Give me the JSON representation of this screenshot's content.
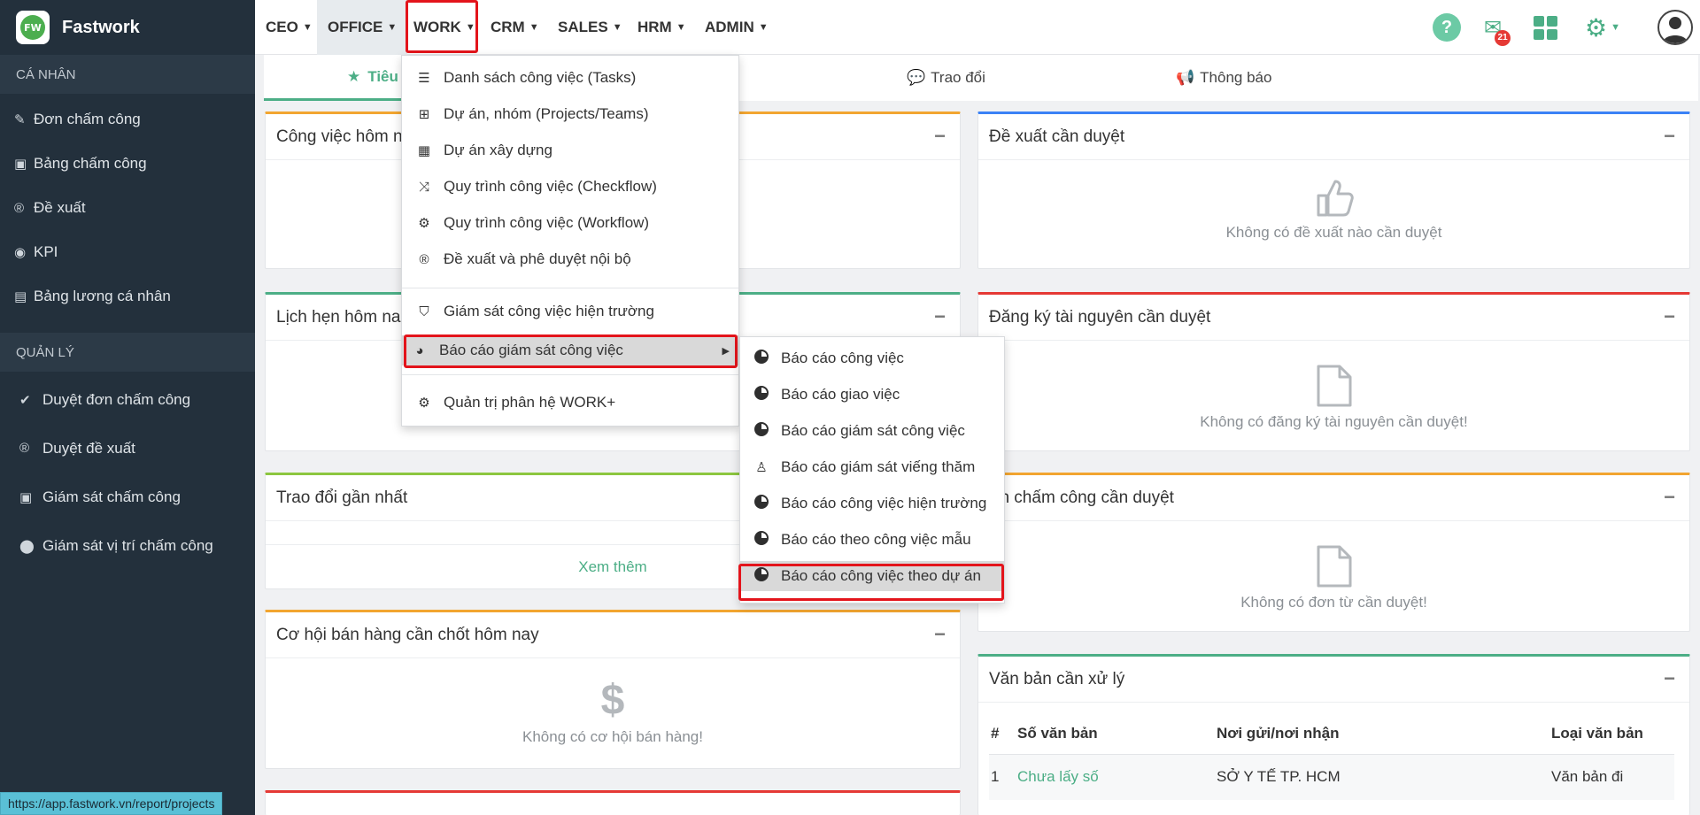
{
  "brand": {
    "name": "Fastwork",
    "logo_text": "FW"
  },
  "sidebar": {
    "personal_title": "CÁ NHÂN",
    "personal_items": [
      {
        "icon": "edit-icon",
        "label": "Đơn chấm công"
      },
      {
        "icon": "calendar-check-icon",
        "label": "Bảng chấm công"
      },
      {
        "icon": "registered-icon",
        "label": "Đề xuất"
      },
      {
        "icon": "eye-icon",
        "label": "KPI"
      },
      {
        "icon": "money-icon",
        "label": "Bảng lương cá nhân"
      }
    ],
    "manage_title": "QUẢN LÝ",
    "manage_items": [
      {
        "icon": "check-circle-icon",
        "label": "Duyệt đơn chấm công"
      },
      {
        "icon": "registered-icon",
        "label": "Duyệt đề xuất"
      },
      {
        "icon": "calendar-check-icon",
        "label": "Giám sát chấm công"
      },
      {
        "icon": "map-marker-icon",
        "label": "Giám sát vị trí chấm công"
      }
    ]
  },
  "status_url": "https://app.fastwork.vn/report/projects",
  "topnav": {
    "items": [
      "CEO",
      "OFFICE",
      "WORK",
      "CRM",
      "SALES",
      "HRM",
      "ADMIN"
    ],
    "mail_badge": "21"
  },
  "tabs": {
    "first": "Tiêu",
    "second": "Trao đổi",
    "third": "Thông báo"
  },
  "panels": {
    "today_tasks": {
      "title": "Công việc hôm n"
    },
    "appointments": {
      "title": "Lịch hẹn hôm na"
    },
    "recent": {
      "title": "Trao đổi gần nhất",
      "more": "Xem thêm"
    },
    "sales": {
      "title": "Cơ hội bán hàng cần chốt hôm nay",
      "empty": "Không có cơ hội bán hàng!",
      "icon_glyph": "$"
    },
    "proposals": {
      "title": "Đề xuất cần duyệt",
      "empty": "Không có đề xuất nào cần duyệt"
    },
    "resources": {
      "title": "Đăng ký tài nguyên cần duyệt",
      "empty": "Không có đăng ký tài nguyên cần duyệt!"
    },
    "attendance": {
      "title": "ơn chấm công cần duyệt",
      "empty": "Không có đơn từ cần duyệt!"
    },
    "documents": {
      "title": "Văn bản cần xử lý",
      "columns": [
        "#",
        "Số văn bản",
        "Nơi gửi/nơi nhận",
        "Loại văn bản"
      ],
      "rows": [
        {
          "num": "1",
          "doc_no": "Chưa lấy số",
          "from_to": "SỞ Y TẾ TP. HCM",
          "type": "Văn bản đi"
        }
      ]
    }
  },
  "work_menu": {
    "items": [
      {
        "icon": "list-icon",
        "label": "Danh sách công việc (Tasks)"
      },
      {
        "icon": "sitemap-icon",
        "label": "Dự án, nhóm (Projects/Teams)"
      },
      {
        "icon": "building-icon",
        "label": "Dự án xây dựng"
      },
      {
        "icon": "random-icon",
        "label": "Quy trình công việc (Checkflow)"
      },
      {
        "icon": "cogs-icon",
        "label": "Quy trình công việc (Workflow)"
      },
      {
        "icon": "registered-icon",
        "label": "Đề xuất và phê duyệt nội bộ"
      },
      {
        "icon": "shield-icon",
        "label": "Giám sát công việc hiện trường"
      },
      {
        "icon": "dashboard-icon",
        "label": "Báo cáo giám sát công việc"
      },
      {
        "icon": "gear-icon",
        "label": "Quản trị phân hệ WORK+"
      }
    ]
  },
  "report_submenu": {
    "items": [
      {
        "icon": "pie-chart-icon",
        "label": "Báo cáo công việc"
      },
      {
        "icon": "pie-chart-icon",
        "label": "Báo cáo giao việc"
      },
      {
        "icon": "pie-chart-icon",
        "label": "Báo cáo giám sát công việc"
      },
      {
        "icon": "street-view-icon",
        "label": "Báo cáo giám sát viếng thăm"
      },
      {
        "icon": "pie-chart-icon",
        "label": "Báo cáo công việc hiện trường"
      },
      {
        "icon": "pie-chart-icon",
        "label": "Báo cáo theo công việc mẫu"
      },
      {
        "icon": "pie-chart-icon",
        "label": "Báo cáo công việc theo dự án"
      }
    ]
  }
}
